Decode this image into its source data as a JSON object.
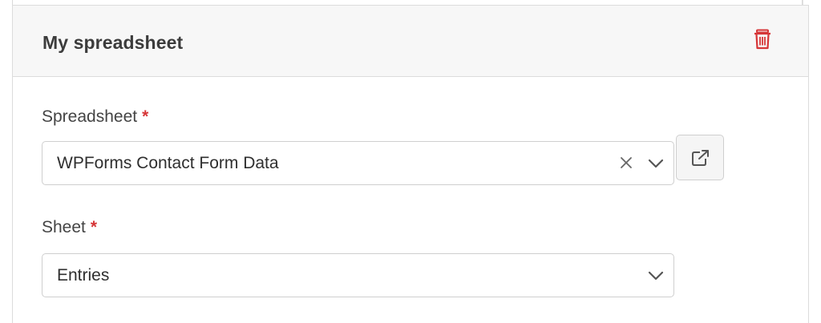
{
  "card": {
    "title": "My spreadsheet"
  },
  "spreadsheet_field": {
    "label": "Spreadsheet",
    "required_mark": "*",
    "value": "WPForms Contact Form Data"
  },
  "sheet_field": {
    "label": "Sheet",
    "required_mark": "*",
    "value": "Entries"
  },
  "icons": {
    "delete": "trash-icon",
    "clear": "close-icon",
    "dropdown": "chevron-down-icon",
    "open": "external-link-icon"
  },
  "colors": {
    "danger": "#d63638",
    "header_background": "#f7f7f7",
    "border": "#cfcfcf"
  }
}
